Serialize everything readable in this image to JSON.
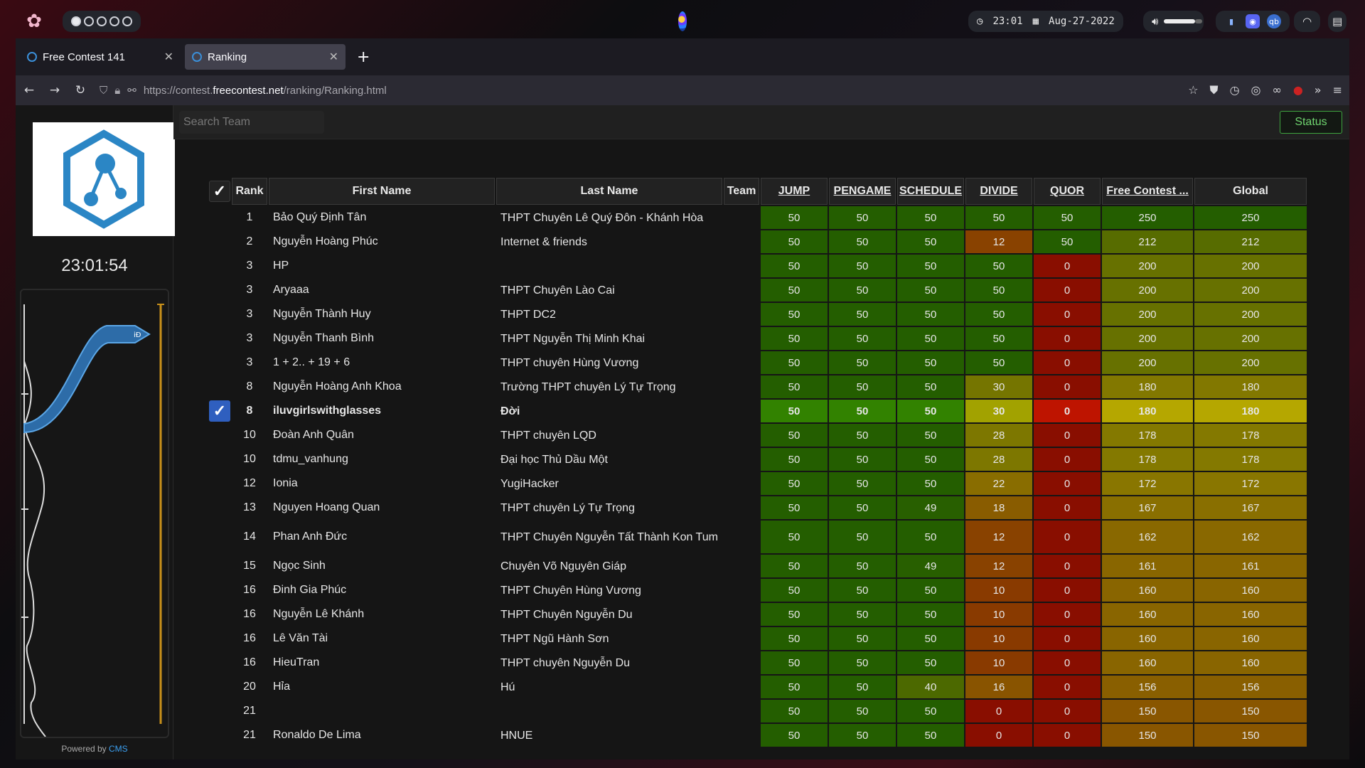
{
  "system_bar": {
    "clock": "23:01",
    "date": "Aug-27-2022",
    "workspaces": [
      true,
      false,
      false,
      false,
      false
    ]
  },
  "browser": {
    "tabs": [
      {
        "label": "Free Contest 141",
        "active": false
      },
      {
        "label": "Ranking",
        "active": true
      }
    ],
    "url_prefix": "https://contest.",
    "url_host": "freecontest.net",
    "url_path": "/ranking/Ranking.html"
  },
  "sidebar": {
    "timer": "23:01:54",
    "powered_prefix": "Powered by ",
    "powered_link": "CMS",
    "graph_label": "iĐ"
  },
  "toolbar": {
    "search_placeholder": "Search Team",
    "status_label": "Status"
  },
  "table": {
    "header_check": "✓",
    "headers": {
      "rank": "Rank",
      "first_name": "First Name",
      "last_name": "Last Name",
      "team": "Team",
      "tasks": [
        "JUMP",
        "PENGAME",
        "SCHEDULE",
        "DIVIDE",
        "QUOR"
      ],
      "contest": "Free Contest ...",
      "global": "Global"
    },
    "rows": [
      {
        "rank": "1",
        "first": "Bảo Quý Định Tân",
        "last": "THPT Chuyên Lê Quý Đôn - Khánh Hòa",
        "scores": [
          50,
          50,
          50,
          50,
          50
        ],
        "contest": 250,
        "global": 250
      },
      {
        "rank": "2",
        "first": "Nguyễn Hoàng Phúc",
        "last": "Internet & friends",
        "scores": [
          50,
          50,
          50,
          12,
          50
        ],
        "contest": 212,
        "global": 212
      },
      {
        "rank": "3",
        "first": "HP",
        "last": "",
        "scores": [
          50,
          50,
          50,
          50,
          0
        ],
        "contest": 200,
        "global": 200
      },
      {
        "rank": "3",
        "first": "Aryaaa",
        "last": "THPT Chuyên Lào Cai",
        "scores": [
          50,
          50,
          50,
          50,
          0
        ],
        "contest": 200,
        "global": 200
      },
      {
        "rank": "3",
        "first": "Nguyễn Thành Huy",
        "last": "THPT DC2",
        "scores": [
          50,
          50,
          50,
          50,
          0
        ],
        "contest": 200,
        "global": 200
      },
      {
        "rank": "3",
        "first": "Nguyễn Thanh Bình",
        "last": "THPT Nguyễn Thị Minh Khai",
        "scores": [
          50,
          50,
          50,
          50,
          0
        ],
        "contest": 200,
        "global": 200
      },
      {
        "rank": "3",
        "first": "1 + 2.. + 19 + 6",
        "last": "THPT chuyên Hùng Vương",
        "scores": [
          50,
          50,
          50,
          50,
          0
        ],
        "contest": 200,
        "global": 200
      },
      {
        "rank": "8",
        "first": "Nguyễn Hoàng Anh Khoa",
        "last": "Trường THPT chuyên Lý Tự Trọng",
        "scores": [
          50,
          50,
          50,
          30,
          0
        ],
        "contest": 180,
        "global": 180
      },
      {
        "rank": "8",
        "first": "iluvgirlswithglasses",
        "last": "Đời",
        "scores": [
          50,
          50,
          50,
          30,
          0
        ],
        "contest": 180,
        "global": 180,
        "selected": true
      },
      {
        "rank": "10",
        "first": "Đoàn Anh Quân",
        "last": "THPT chuyên LQD",
        "scores": [
          50,
          50,
          50,
          28,
          0
        ],
        "contest": 178,
        "global": 178
      },
      {
        "rank": "10",
        "first": "tdmu_vanhung",
        "last": "Đại học Thủ Dầu Một",
        "scores": [
          50,
          50,
          50,
          28,
          0
        ],
        "contest": 178,
        "global": 178
      },
      {
        "rank": "12",
        "first": "Ionia",
        "last": "YugiHacker",
        "scores": [
          50,
          50,
          50,
          22,
          0
        ],
        "contest": 172,
        "global": 172
      },
      {
        "rank": "13",
        "first": "Nguyen Hoang Quan",
        "last": "THPT chuyên Lý Tự Trọng",
        "scores": [
          50,
          50,
          49,
          18,
          0
        ],
        "contest": 167,
        "global": 167
      },
      {
        "rank": "14",
        "first": "Phan Anh Đức",
        "last": "THPT Chuyên Nguyễn Tất Thành Kon Tum",
        "scores": [
          50,
          50,
          50,
          12,
          0
        ],
        "contest": 162,
        "global": 162,
        "tall": true
      },
      {
        "rank": "15",
        "first": "Ngọc Sinh",
        "last": "Chuyên Võ Nguyên Giáp",
        "scores": [
          50,
          50,
          49,
          12,
          0
        ],
        "contest": 161,
        "global": 161
      },
      {
        "rank": "16",
        "first": "Đinh Gia Phúc",
        "last": "THPT Chuyên Hùng Vương",
        "scores": [
          50,
          50,
          50,
          10,
          0
        ],
        "contest": 160,
        "global": 160
      },
      {
        "rank": "16",
        "first": "Nguyễn Lê Khánh",
        "last": "THPT Chuyên Nguyễn Du",
        "scores": [
          50,
          50,
          50,
          10,
          0
        ],
        "contest": 160,
        "global": 160
      },
      {
        "rank": "16",
        "first": "Lê Văn Tài",
        "last": "THPT Ngũ Hành Sơn",
        "scores": [
          50,
          50,
          50,
          10,
          0
        ],
        "contest": 160,
        "global": 160
      },
      {
        "rank": "16",
        "first": "HieuTran",
        "last": "THPT chuyên Nguyễn Du",
        "scores": [
          50,
          50,
          50,
          10,
          0
        ],
        "contest": 160,
        "global": 160
      },
      {
        "rank": "20",
        "first": "Hỉa",
        "last": "Hú",
        "scores": [
          50,
          50,
          40,
          16,
          0
        ],
        "contest": 156,
        "global": 156
      },
      {
        "rank": "21",
        "first": "",
        "last": "",
        "scores": [
          50,
          50,
          50,
          0,
          0
        ],
        "contest": 150,
        "global": 150
      },
      {
        "rank": "21",
        "first": "Ronaldo De Lima",
        "last": "HNUE",
        "scores": [
          50,
          50,
          50,
          0,
          0
        ],
        "contest": 150,
        "global": 150
      }
    ]
  }
}
